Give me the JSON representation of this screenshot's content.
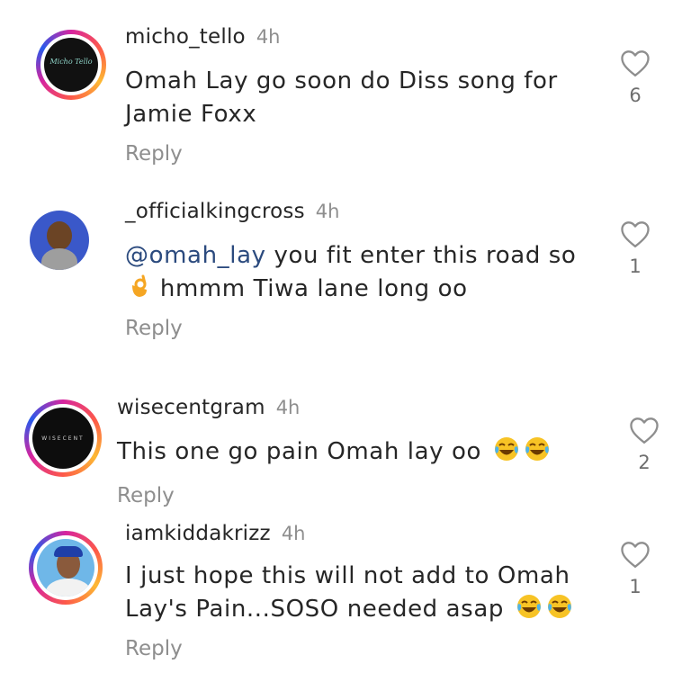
{
  "comments": [
    {
      "username": "micho_tello",
      "time": "4h",
      "lines": [
        "Omah Lay go soon do Diss song for",
        "Jamie Foxx"
      ],
      "reply_label": "Reply",
      "likes": "6",
      "avatar_text": "Micho Tello"
    },
    {
      "username": "_officialkingcross",
      "time": "4h",
      "mention": "@omah_lay",
      "line1_rest": " you fit enter this road so",
      "line2": " hmmm Tiwa lane long oo",
      "reply_label": "Reply",
      "likes": "1"
    },
    {
      "username": "wisecentgram",
      "time": "4h",
      "text": "This one go pain Omah lay oo",
      "reply_label": "Reply",
      "likes": "2",
      "avatar_text": "WISECENT"
    },
    {
      "username": "iamkiddakrizz",
      "time": "4h",
      "line1": "I just hope this will not add to Omah",
      "line2": "Lay's Pain...SOSO needed asap",
      "reply_label": "Reply",
      "likes": "1"
    }
  ],
  "icons": {
    "like": "heart-outline-icon",
    "laugh": "face-with-tears-of-joy-icon",
    "ok": "ok-hand-icon"
  },
  "colors": {
    "accent": "#2b4a7e",
    "muted": "#8e8e8e",
    "ring_pink": "#d6249f",
    "ring_orange": "#fd5949"
  }
}
